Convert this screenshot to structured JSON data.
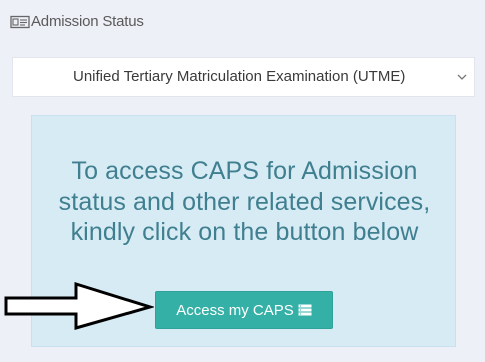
{
  "header": {
    "title": "Admission Status",
    "icon": "id-card-icon"
  },
  "exam_select": {
    "selected": "Unified Tertiary Matriculation Examination (UTME)",
    "icon": "chevron-down-icon"
  },
  "info_panel": {
    "message": "To access CAPS for Admission status and other related services, kindly click on the button below"
  },
  "cta": {
    "label": "Access my CAPS",
    "icon": "server-icon",
    "color": "#35b0a6"
  },
  "annotation": {
    "icon": "arrow-right-icon"
  }
}
